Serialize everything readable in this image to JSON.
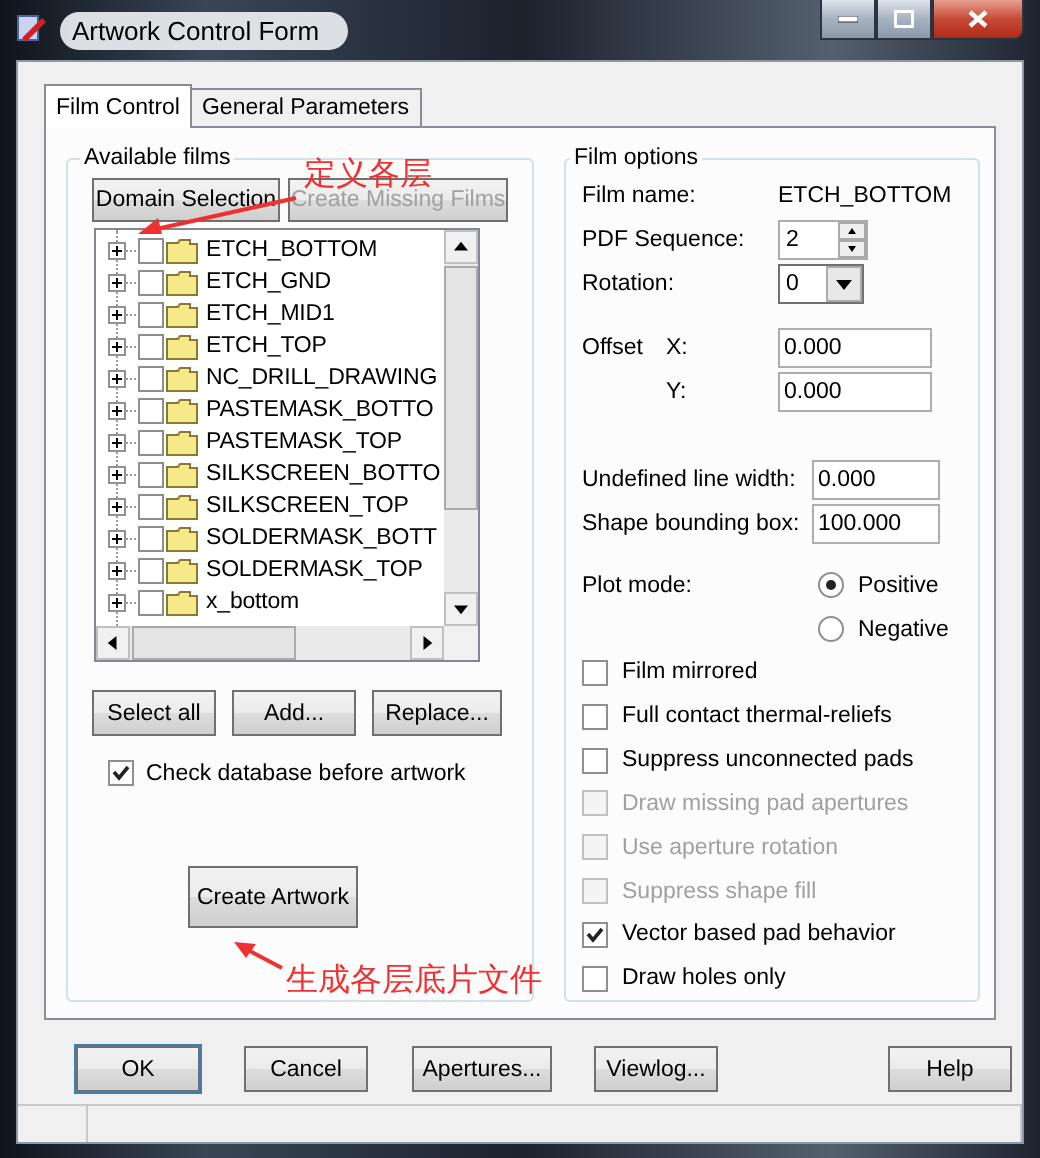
{
  "window": {
    "title": "Artwork Control Form"
  },
  "tabs": [
    {
      "label": "Film Control",
      "selected": true
    },
    {
      "label": "General Parameters",
      "selected": false
    }
  ],
  "available_films": {
    "title": "Available films",
    "top_buttons": [
      {
        "label": "Domain Selection",
        "disabled": false
      },
      {
        "label": "Create Missing Films",
        "disabled": true
      }
    ],
    "films": [
      {
        "label": "ETCH_BOTTOM",
        "checked": false
      },
      {
        "label": "ETCH_GND",
        "checked": false
      },
      {
        "label": "ETCH_MID1",
        "checked": false
      },
      {
        "label": "ETCH_TOP",
        "checked": false
      },
      {
        "label": "NC_DRILL_DRAWING",
        "checked": false
      },
      {
        "label": "PASTEMASK_BOTTO",
        "checked": false
      },
      {
        "label": "PASTEMASK_TOP",
        "checked": false
      },
      {
        "label": "SILKSCREEN_BOTTO",
        "checked": false
      },
      {
        "label": "SILKSCREEN_TOP",
        "checked": false
      },
      {
        "label": "SOLDERMASK_BOTT",
        "checked": false
      },
      {
        "label": "SOLDERMASK_TOP",
        "checked": false
      },
      {
        "label": "x_bottom",
        "checked": false
      }
    ],
    "actions": [
      "Select all",
      "Add...",
      "Replace..."
    ],
    "check_database": {
      "label": "Check database before artwork",
      "checked": true
    },
    "create_button": "Create Artwork"
  },
  "film_options": {
    "title": "Film options",
    "film_name": {
      "label": "Film name:",
      "value": "ETCH_BOTTOM"
    },
    "pdf_sequence": {
      "label": "PDF Sequence:",
      "value": "2"
    },
    "rotation": {
      "label": "Rotation:",
      "value": "0"
    },
    "offset": {
      "label": "Offset",
      "x_label": "X:",
      "x_value": "0.000",
      "y_label": "Y:",
      "y_value": "0.000"
    },
    "undefined_line_width": {
      "label": "Undefined line width:",
      "value": "0.000"
    },
    "shape_bounding_box": {
      "label": "Shape bounding box:",
      "value": "100.000"
    },
    "plot_mode": {
      "label": "Plot mode:",
      "options": [
        {
          "label": "Positive",
          "selected": true
        },
        {
          "label": "Negative",
          "selected": false
        }
      ]
    },
    "checkboxes": [
      {
        "label": "Film mirrored",
        "checked": false,
        "disabled": false
      },
      {
        "label": "Full contact thermal-reliefs",
        "checked": false,
        "disabled": false
      },
      {
        "label": "Suppress unconnected pads",
        "checked": false,
        "disabled": false
      },
      {
        "label": "Draw missing pad apertures",
        "checked": false,
        "disabled": true
      },
      {
        "label": "Use aperture rotation",
        "checked": false,
        "disabled": true
      },
      {
        "label": "Suppress shape fill",
        "checked": false,
        "disabled": true
      },
      {
        "label": "Vector based pad behavior",
        "checked": true,
        "disabled": false
      },
      {
        "label": "Draw holes only",
        "checked": false,
        "disabled": false
      }
    ]
  },
  "footer_buttons": [
    "OK",
    "Cancel",
    "Apertures...",
    "Viewlog...",
    "Help"
  ],
  "annotations": [
    "定义各层",
    "生成各层底片文件"
  ]
}
